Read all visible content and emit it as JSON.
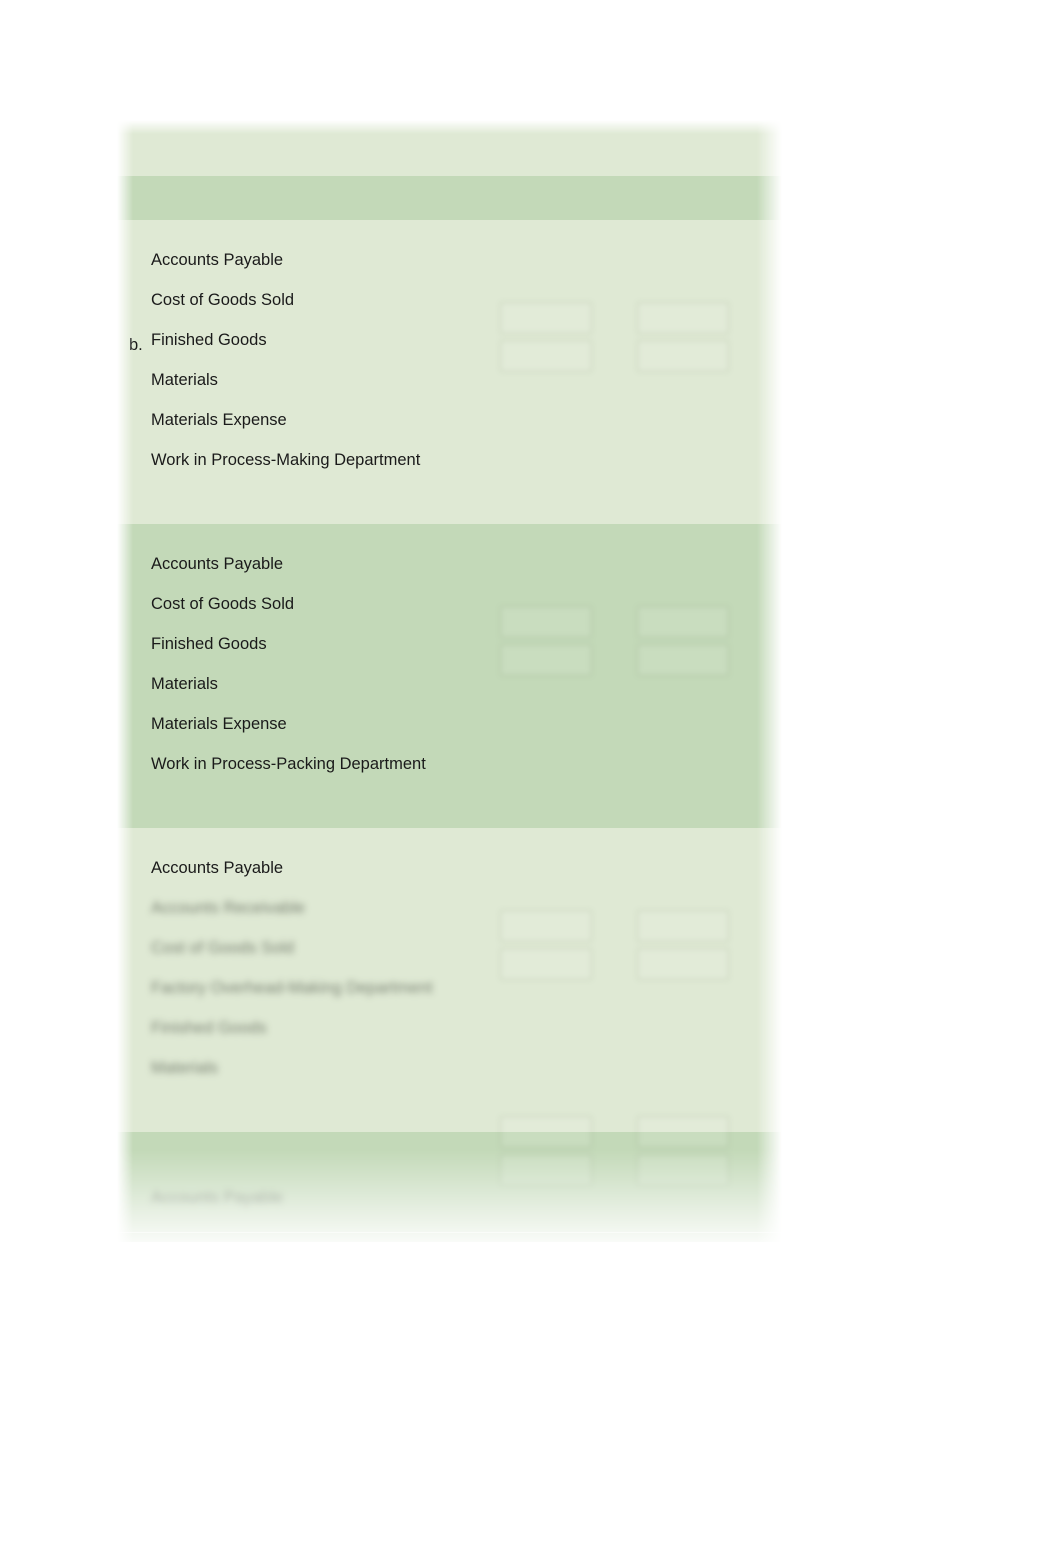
{
  "worksheet": {
    "item_marker": "b.",
    "sections": [
      {
        "id": "top-partial",
        "shade": "light",
        "truncated_top": true,
        "partial_label": "",
        "options": []
      },
      {
        "id": "entry-making-department",
        "shade": "light",
        "options": [
          "Accounts Payable",
          "Cost of Goods Sold",
          "Finished Goods",
          "Materials",
          "Materials Expense",
          "Work in Process-Making Department"
        ],
        "trailing_option": "",
        "amount_columns": [
          "debit",
          "credit"
        ],
        "amount_rows": 2
      },
      {
        "id": "entry-packing-department",
        "shade": "dark",
        "options": [
          "Accounts Payable",
          "Cost of Goods Sold",
          "Finished Goods",
          "Materials",
          "Materials Expense",
          "Work in Process-Packing Department"
        ],
        "trailing_option": "",
        "amount_columns": [
          "debit",
          "credit"
        ],
        "amount_rows": 2
      },
      {
        "id": "entry-factory-overhead",
        "shade": "light",
        "options": [
          "Accounts Payable",
          "Accounts Receivable",
          "Cost of Goods Sold",
          "Factory Overhead-Making Department",
          "Finished Goods",
          "Materials"
        ],
        "trailing_option": "",
        "amount_columns": [
          "debit",
          "credit"
        ],
        "amount_rows": 2
      },
      {
        "id": "entry-bottom-partial",
        "shade": "dark",
        "truncated_bottom": true,
        "options": [
          "Accounts Payable"
        ],
        "amount_columns": [
          "debit",
          "credit"
        ],
        "amount_rows": 2
      }
    ]
  },
  "colors": {
    "band_light": "#dfe9d4",
    "band_dark": "#c3d9b8",
    "text": "#1a1a1a",
    "page_background": "#ffffff",
    "cell_border": "#59684c"
  }
}
